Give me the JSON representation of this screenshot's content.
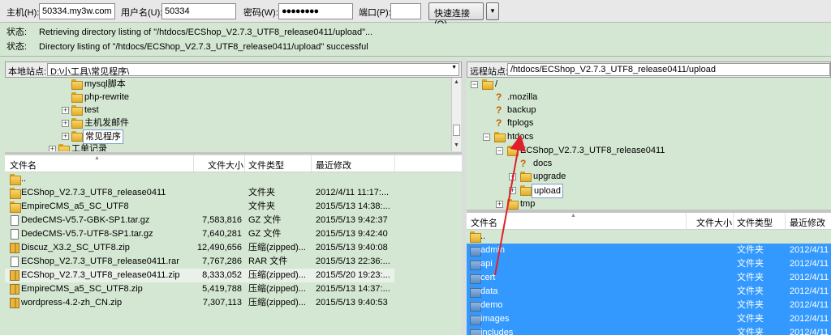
{
  "quickconnect": {
    "host_label": "主机(H):",
    "host_value": "50334.my3w.com",
    "user_label": "用户名(U):",
    "user_value": "50334",
    "pass_label": "密码(W):",
    "pass_value": "●●●●●●●●",
    "port_label": "端口(P):",
    "port_value": "",
    "connect_button": "快速连接(Q)",
    "dropdown_icon": "chevron-down-icon"
  },
  "log": [
    {
      "key": "状态:",
      "text": "Retrieving directory listing of \"/htdocs/ECShop_V2.7.3_UTF8_release0411/upload\"..."
    },
    {
      "key": "状态:",
      "text": "Directory listing of \"/htdocs/ECShop_V2.7.3_UTF8_release0411/upload\" successful"
    }
  ],
  "local": {
    "site_label": "本地站点:",
    "site_path": "D:\\小工具\\常见程序\\",
    "tree": [
      {
        "label": "mysql脚本"
      },
      {
        "label": "php-rewrite"
      },
      {
        "label": "test",
        "expander": "+"
      },
      {
        "label": "主机发邮件",
        "expander": "+"
      },
      {
        "label": "常见程序",
        "expander": "+"
      },
      {
        "label": "工单记录",
        "expander": "+"
      }
    ],
    "columns": [
      "文件名",
      "文件大小",
      "文件类型",
      "最近修改"
    ],
    "files": [
      {
        "name": "..",
        "size": "",
        "type": "",
        "modified": "",
        "icon": "folder"
      },
      {
        "name": "ECShop_V2.7.3_UTF8_release0411",
        "size": "",
        "type": "文件夹",
        "modified": "2012/4/11 11:17:...",
        "icon": "folder"
      },
      {
        "name": "EmpireCMS_a5_SC_UTF8",
        "size": "",
        "type": "文件夹",
        "modified": "2015/5/13 14:38:...",
        "icon": "folder"
      },
      {
        "name": "DedeCMS-V5.7-GBK-SP1.tar.gz",
        "size": "7,583,816",
        "type": "GZ 文件",
        "modified": "2015/5/13 9:42:37",
        "icon": "file"
      },
      {
        "name": "DedeCMS-V5.7-UTF8-SP1.tar.gz",
        "size": "7,640,281",
        "type": "GZ 文件",
        "modified": "2015/5/13 9:42:40",
        "icon": "file"
      },
      {
        "name": "Discuz_X3.2_SC_UTF8.zip",
        "size": "12,490,656",
        "type": "压缩(zipped)...",
        "modified": "2015/5/13 9:40:08",
        "icon": "zip"
      },
      {
        "name": "ECShop_V2.7.3_UTF8_release0411.rar",
        "size": "7,767,286",
        "type": "RAR 文件",
        "modified": "2015/5/13 22:36:...",
        "icon": "file"
      },
      {
        "name": "ECShop_V2.7.3_UTF8_release0411.zip",
        "size": "8,333,052",
        "type": "压缩(zipped)...",
        "modified": "2015/5/20 19:23:...",
        "icon": "zip"
      },
      {
        "name": "EmpireCMS_a5_SC_UTF8.zip",
        "size": "5,419,788",
        "type": "压缩(zipped)...",
        "modified": "2015/5/13 14:37:...",
        "icon": "zip"
      },
      {
        "name": "wordpress-4.2-zh_CN.zip",
        "size": "7,307,113",
        "type": "压缩(zipped)...",
        "modified": "2015/5/13 9:40:53",
        "icon": "zip"
      }
    ]
  },
  "remote": {
    "site_label": "远程站点:",
    "site_path": "/htdocs/ECShop_V2.7.3_UTF8_release0411/upload",
    "tree": [
      {
        "label": "/",
        "expander": "−",
        "icon": "folder"
      },
      {
        "label": ".mozilla",
        "icon": "unknown"
      },
      {
        "label": "backup",
        "icon": "unknown"
      },
      {
        "label": "ftplogs",
        "icon": "unknown"
      },
      {
        "label": "htdocs",
        "expander": "−",
        "icon": "folder"
      },
      {
        "label": "ECShop_V2.7.3_UTF8_release0411",
        "expander": "−",
        "icon": "folder"
      },
      {
        "label": "docs",
        "icon": "unknown"
      },
      {
        "label": "upgrade",
        "expander": "+",
        "icon": "folder"
      },
      {
        "label": "upload",
        "expander": "+",
        "icon": "folder"
      },
      {
        "label": "tmp",
        "expander": "+",
        "icon": "folder"
      }
    ],
    "columns": [
      "文件名",
      "文件大小",
      "文件类型",
      "最近修改"
    ],
    "files": [
      {
        "name": "..",
        "type": "",
        "modified": "",
        "selected": false
      },
      {
        "name": "admin",
        "type": "文件夹",
        "modified": "2012/4/11",
        "selected": true
      },
      {
        "name": "api",
        "type": "文件夹",
        "modified": "2012/4/11",
        "selected": true
      },
      {
        "name": "cert",
        "type": "文件夹",
        "modified": "2012/4/11",
        "selected": true
      },
      {
        "name": "data",
        "type": "文件夹",
        "modified": "2012/4/11",
        "selected": true
      },
      {
        "name": "demo",
        "type": "文件夹",
        "modified": "2012/4/11",
        "selected": true
      },
      {
        "name": "images",
        "type": "文件夹",
        "modified": "2012/4/11",
        "selected": true
      },
      {
        "name": "includes",
        "type": "文件夹",
        "modified": "2012/4/11",
        "selected": true
      }
    ]
  },
  "colors": {
    "pane_bg": "#d4e7d2",
    "selection": "#3399ff",
    "annotation_arrow": "#e0202a"
  }
}
